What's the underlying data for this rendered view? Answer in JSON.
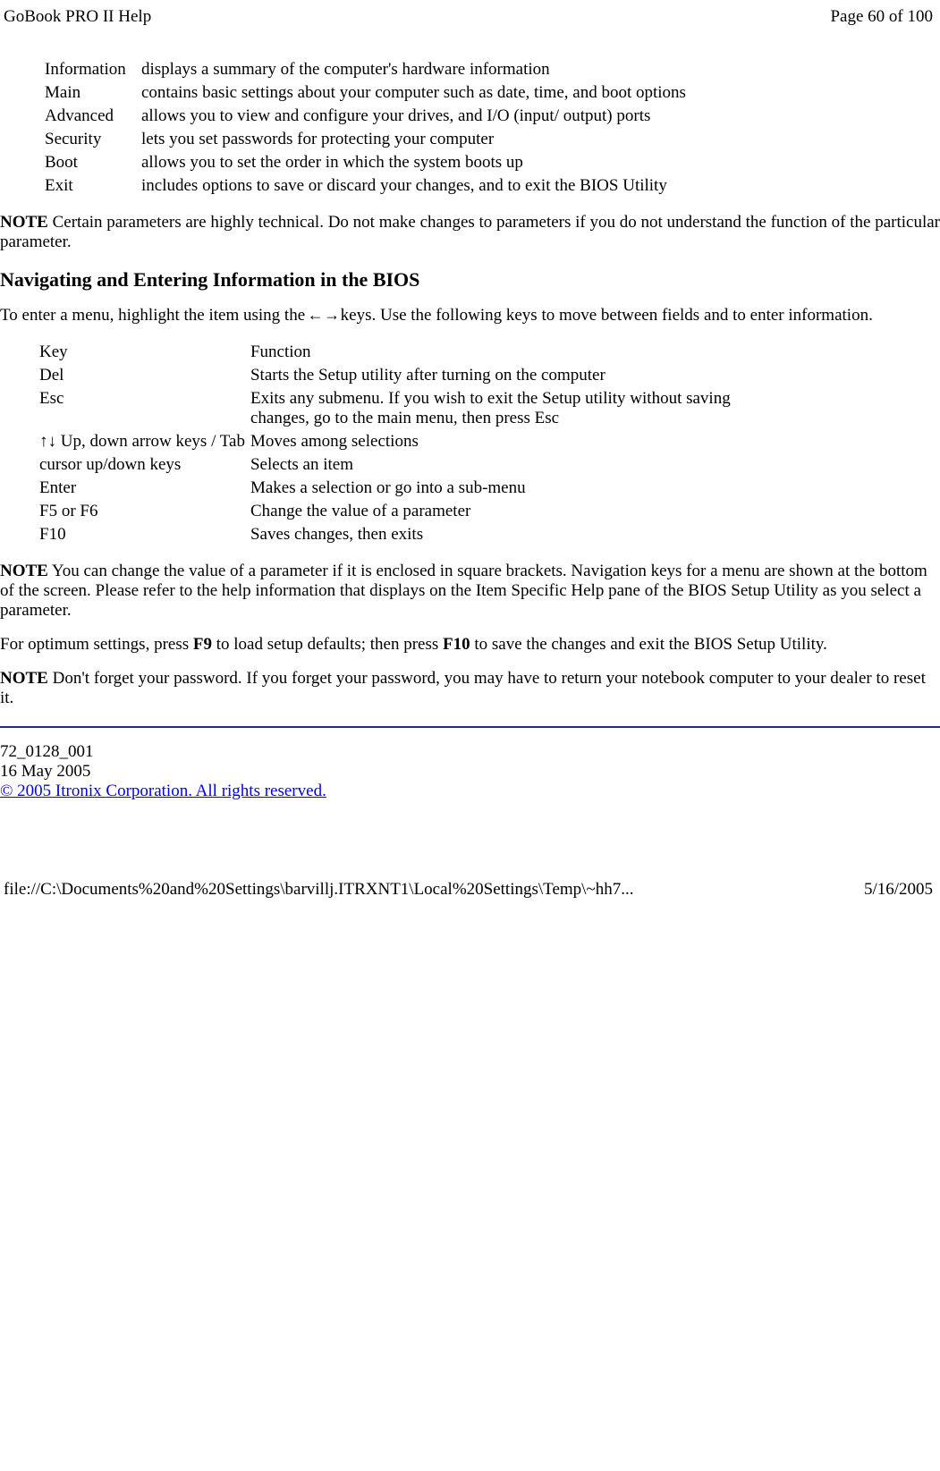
{
  "header": {
    "title": "GoBook PRO II Help",
    "page": "Page 60 of 100"
  },
  "menu_items": [
    {
      "name": "Information",
      "desc": "displays a summary of the computer's hardware information"
    },
    {
      "name": "Main",
      "desc": "contains basic settings about your computer such as date, time, and boot options"
    },
    {
      "name": "Advanced",
      "desc": "allows you to view and configure your drives, and I/O (input/ output) ports"
    },
    {
      "name": "Security",
      "desc": " lets you set passwords for protecting your computer"
    },
    {
      "name": "Boot",
      "desc": "allows you to set the order in which the system boots up"
    },
    {
      "name": "Exit",
      "desc": " includes options to save or discard your changes, and to exit the BIOS Utility"
    }
  ],
  "note1_label": "NOTE",
  "note1_text": "  Certain parameters are highly technical. Do not make changes to parameters if you do not understand the function of the particular parameter.",
  "heading": "Navigating and Entering Information in the BIOS",
  "intro_pre": "To enter a menu, highlight the item using the",
  "intro_post": " keys. Use the following keys to move between fields and to enter information.",
  "key_table_header": {
    "key": "Key",
    "func": "Function"
  },
  "key_rows": [
    {
      "key": "Del",
      "func": "Starts the Setup utility after turning on the computer"
    },
    {
      "key": "Esc",
      "func": "Exits any submenu.  If you wish to exit the Setup utility without saving changes, go to the main menu, then press Esc"
    }
  ],
  "key_updown_label": " Up, down arrow keys / Tab",
  "key_updown_func": "Moves among selections",
  "key_rows2": [
    {
      "key": "cursor up/down keys",
      "func": "Selects an item"
    },
    {
      "key": "Enter",
      "func": "Makes a selection or go into a sub-menu"
    },
    {
      "key": "F5 or F6",
      "func": "Change the value of a parameter"
    },
    {
      "key": "F10",
      "func": "Saves changes, then exits"
    }
  ],
  "note2_label": "NOTE",
  "note2_text": "  You can change the value of a parameter if it is enclosed in square brackets. Navigation keys for a menu are shown at the bottom of the screen. Please refer to the help information that displays on the Item Specific Help pane of the BIOS Setup Utility as you select a parameter.",
  "optimum_pre": "For optimum settings, press ",
  "optimum_f9": "F9",
  "optimum_mid": " to load setup defaults; then press ",
  "optimum_f10": "F10",
  "optimum_post": " to save the changes and exit the BIOS Setup Utility.",
  "note3_label": "NOTE",
  "note3_text": " Don't forget your password. If you forget your password, you may have to return your notebook computer to your dealer to reset it.",
  "doc_id": " 72_0128_001",
  "doc_date": "16 May 2005",
  "copyright": "© 2005 Itronix Corporation.  All rights reserved.",
  "footer": {
    "path": "file://C:\\Documents%20and%20Settings\\barvillj.ITRXNT1\\Local%20Settings\\Temp\\~hh7...",
    "date": "5/16/2005"
  }
}
